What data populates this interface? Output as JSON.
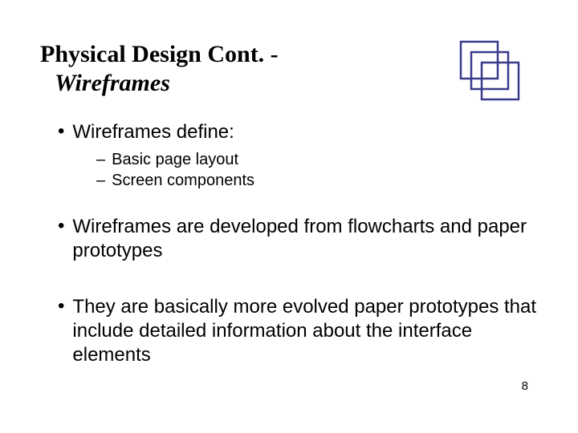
{
  "title": {
    "main": "Physical Design Cont. -",
    "sub": "Wireframes"
  },
  "bullets": [
    {
      "text": "Wireframes define:",
      "sub": [
        "Basic page layout",
        "Screen components"
      ]
    },
    {
      "text": "Wireframes are developed from flowcharts and paper prototypes",
      "sub": []
    },
    {
      "text": "They are basically more evolved paper prototypes that include detailed information about the interface elements",
      "sub": []
    }
  ],
  "page_number": "8",
  "logo_color": "#3a3a8c"
}
